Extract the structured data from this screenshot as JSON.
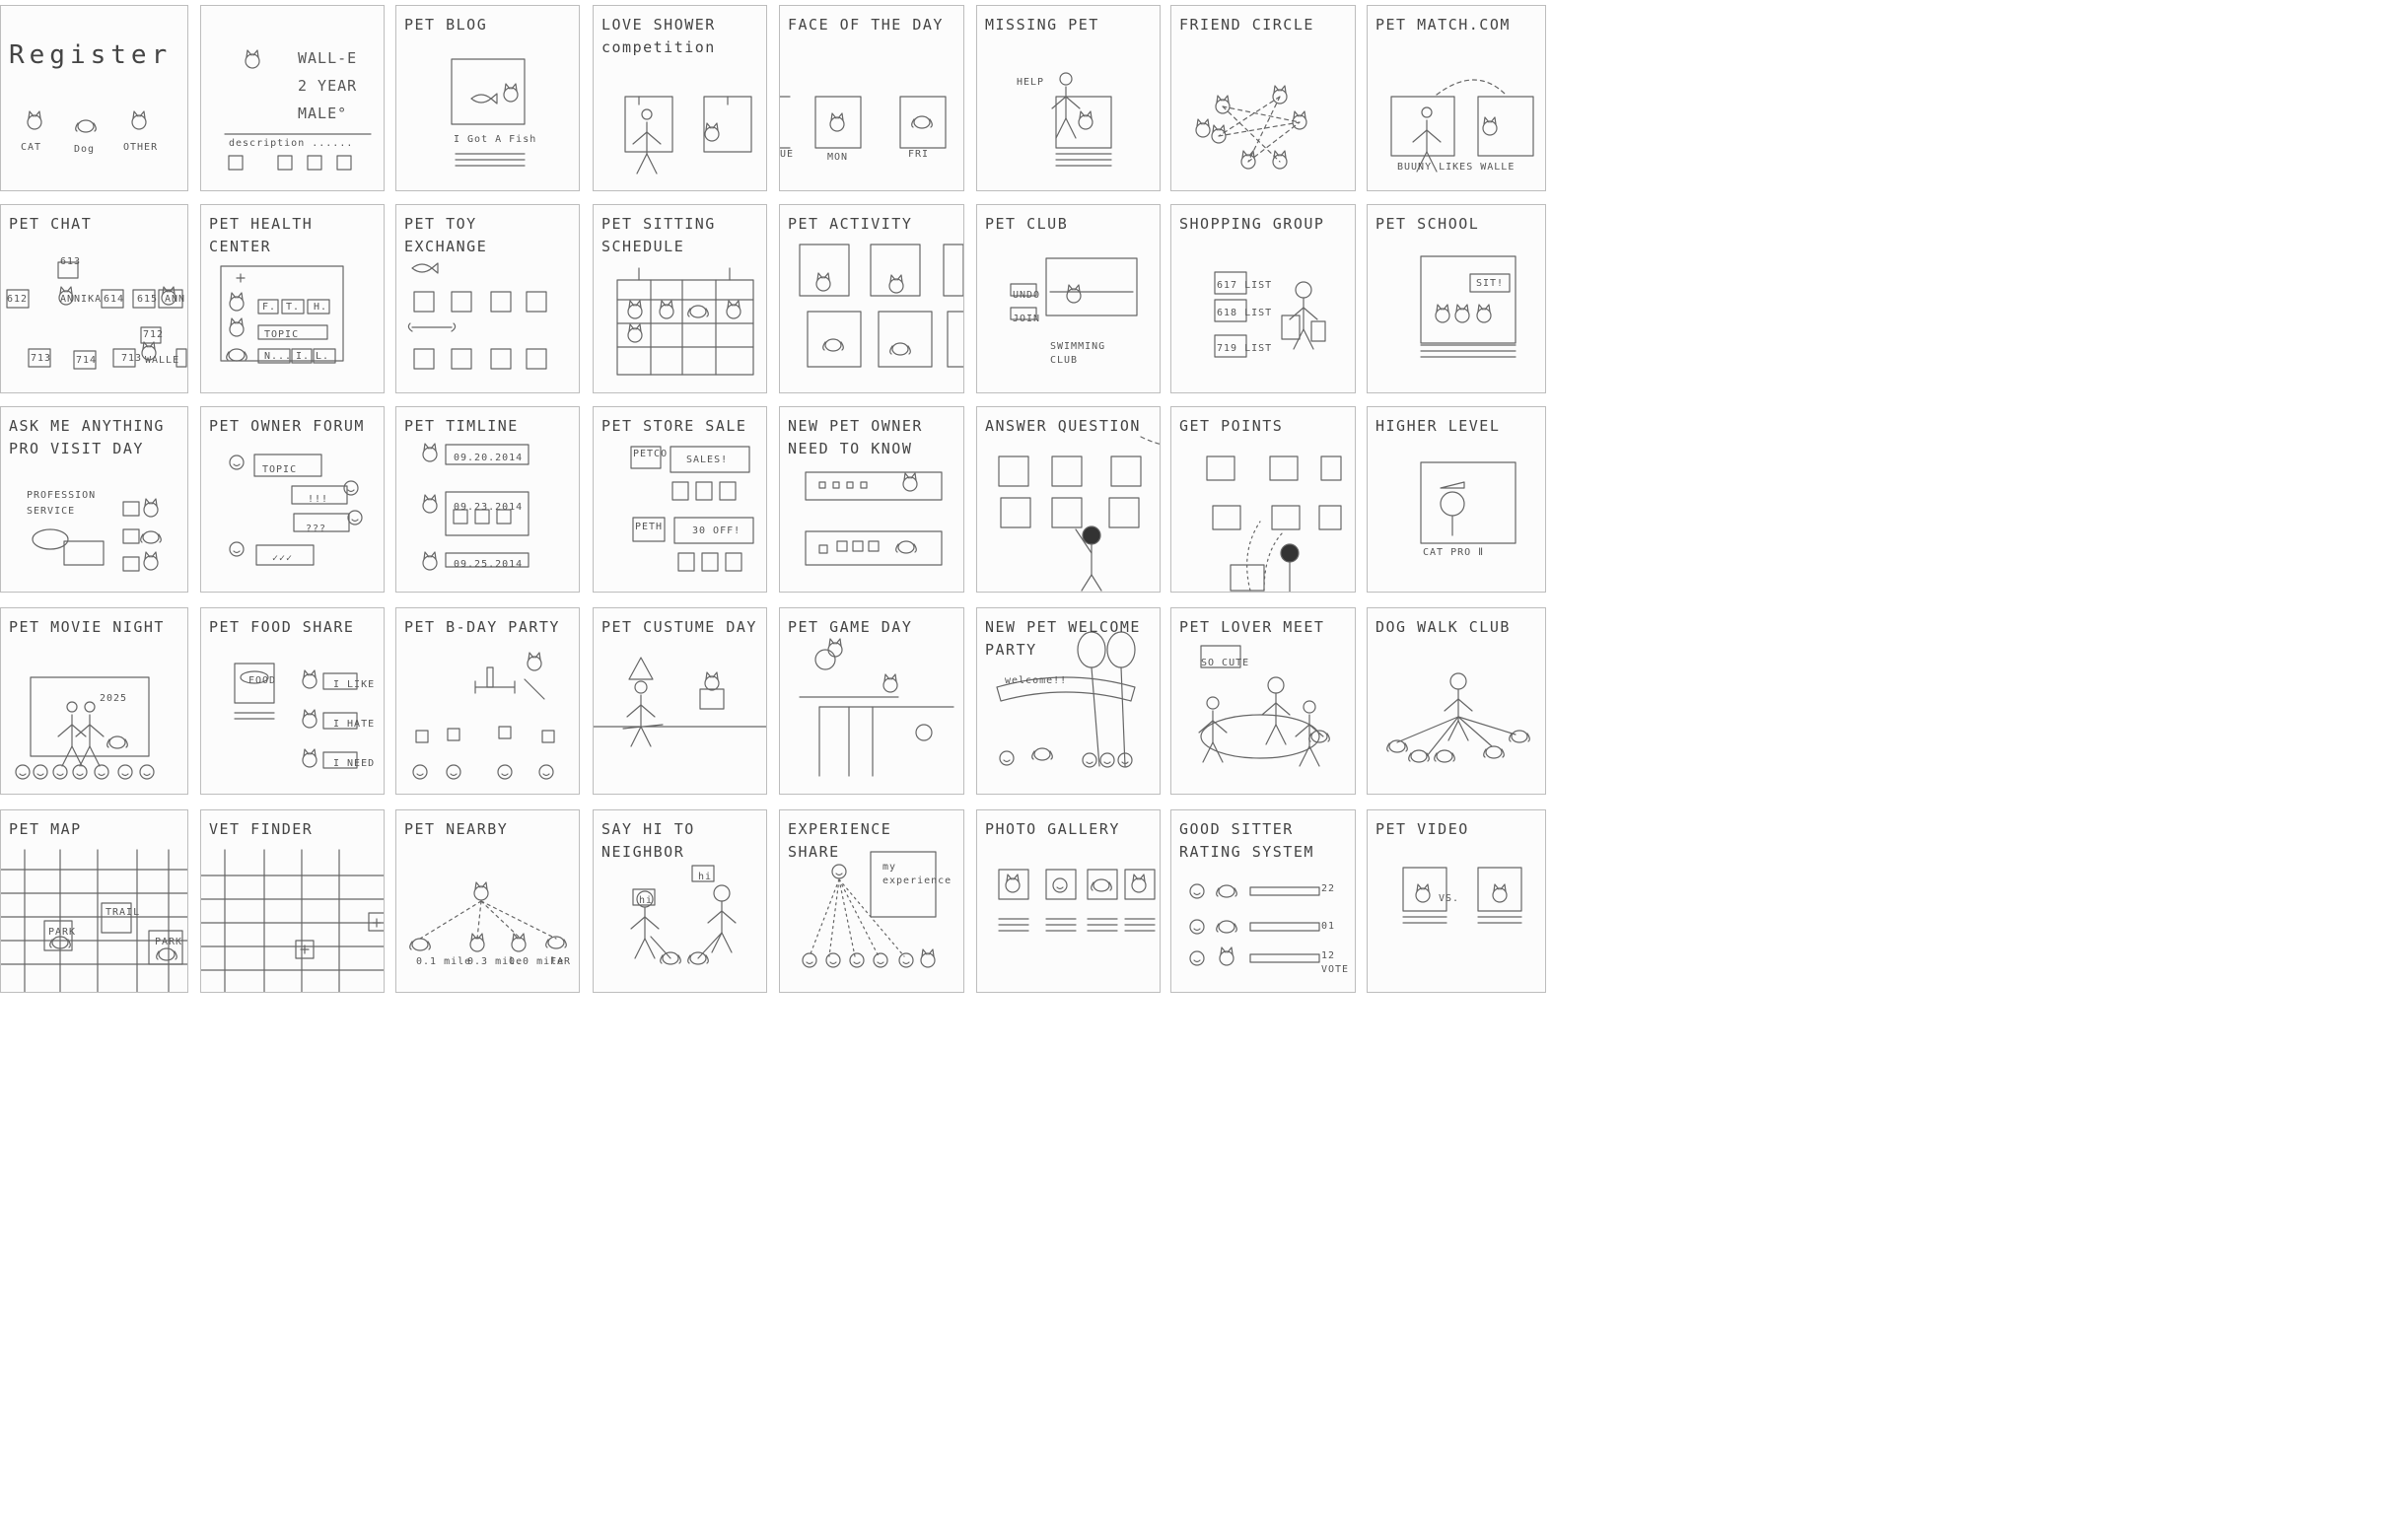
{
  "panels": [
    {
      "title": "Register",
      "labels": [
        "CAT",
        "Dog",
        "OTHER"
      ]
    },
    {
      "title": "",
      "labels": [
        "WALL-E",
        "2 YEAR",
        "MALE°",
        "description ......"
      ]
    },
    {
      "title": "PET BLOG",
      "labels": [
        "I Got A Fish"
      ]
    },
    {
      "title": "LOVE SHOWER\ncompetition",
      "labels": []
    },
    {
      "title": "FACE OF THE DAY",
      "labels": [
        "UE",
        "MON",
        "FRI"
      ]
    },
    {
      "title": "MISSING PET",
      "labels": [
        "HELP"
      ]
    },
    {
      "title": "FRIEND CIRCLE",
      "labels": []
    },
    {
      "title": "PET MATCH.COM",
      "labels": [
        "BUUNY LIKES WALLE"
      ]
    },
    {
      "title": "PET CHAT",
      "labels": [
        "612",
        "613",
        "614",
        "615",
        "713",
        "714",
        "713",
        "712",
        "ANNIKA",
        "ANN",
        "WALLE"
      ]
    },
    {
      "title": "PET HEALTH\nCENTER",
      "labels": [
        "F.",
        "T.",
        "H.",
        "TOPIC",
        "N...",
        "I.",
        "L."
      ]
    },
    {
      "title": "PET TOY\nEXCHANGE",
      "labels": []
    },
    {
      "title": "PET SITTING\nSCHEDULE",
      "labels": []
    },
    {
      "title": "PET ACTIVITY",
      "labels": []
    },
    {
      "title": "PET CLUB",
      "labels": [
        "UNDO",
        "JOIN",
        "SWIMMING",
        "CLUB"
      ]
    },
    {
      "title": "SHOPPING GROUP",
      "labels": [
        "617 LIST",
        "618 LIST",
        "719 LIST"
      ]
    },
    {
      "title": "PET SCHOOL",
      "labels": [
        "SIT!"
      ]
    },
    {
      "title": "ASK ME ANYTHING\nPRO VISIT DAY",
      "labels": [
        "PROFESSION",
        "SERVICE"
      ]
    },
    {
      "title": "PET OWNER FORUM",
      "labels": [
        "TOPIC",
        "!!!",
        "???",
        "✓✓✓"
      ]
    },
    {
      "title": "PET TIMLINE",
      "labels": [
        "09.20.2014",
        "09.23.2014",
        "09.25.2014"
      ]
    },
    {
      "title": "PET STORE SALE",
      "labels": [
        "PETCO",
        "SALES!",
        "PETH",
        "30 OFF!"
      ]
    },
    {
      "title": "NEW PET OWNER\nNEED TO KNOW",
      "labels": []
    },
    {
      "title": "ANSWER QUESTION",
      "labels": []
    },
    {
      "title": "GET POINTS",
      "labels": []
    },
    {
      "title": "HIGHER LEVEL",
      "labels": [
        "CAT PRO Ⅱ"
      ]
    },
    {
      "title": "PET MOVIE NIGHT",
      "labels": [
        "2025"
      ]
    },
    {
      "title": "PET FOOD SHARE",
      "labels": [
        "FOOD",
        "I LIKE",
        "I HATE",
        "I NEED"
      ]
    },
    {
      "title": "PET B-DAY PARTY",
      "labels": []
    },
    {
      "title": "PET CUSTUME DAY",
      "labels": []
    },
    {
      "title": "PET GAME DAY",
      "labels": []
    },
    {
      "title": "NEW PET WELCOME\nPARTY",
      "labels": [
        "welcome!!"
      ]
    },
    {
      "title": "PET LOVER MEET",
      "labels": [
        "SO CUTE"
      ]
    },
    {
      "title": "DOG WALK CLUB",
      "labels": []
    },
    {
      "title": "PET MAP",
      "labels": [
        "PARK",
        "TRAIL",
        "PARK"
      ]
    },
    {
      "title": "VET FINDER",
      "labels": []
    },
    {
      "title": "PET NEARBY",
      "labels": [
        "0.1 mile",
        "0.3 mile",
        "0.0 mile",
        "FAR"
      ]
    },
    {
      "title": "SAY HI TO NEIGHBOR",
      "labels": [
        "hi",
        "hi"
      ]
    },
    {
      "title": "EXPERIENCE\nSHARE",
      "labels": [
        "my",
        "experience"
      ]
    },
    {
      "title": "PHOTO GALLERY",
      "labels": []
    },
    {
      "title": "GOOD SITTER\nRATING SYSTEM",
      "labels": [
        "22",
        "01",
        "12",
        "VOTE"
      ]
    },
    {
      "title": "PET VIDEO",
      "labels": [
        "VS."
      ]
    }
  ]
}
